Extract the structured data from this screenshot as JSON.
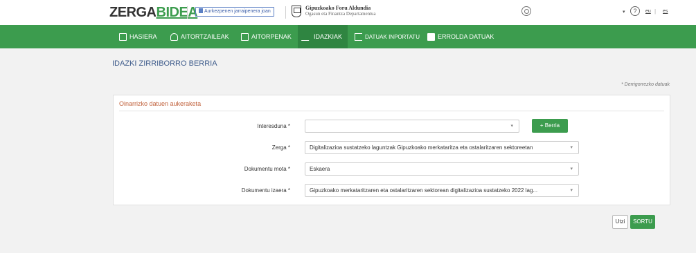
{
  "header": {
    "logo_part1": "ZERGA",
    "logo_part2": "BIDEA",
    "followup_label": "Aurkezpenen jarraipenera joan",
    "dept_line1": "Gipuzkoako Foru Aldundia",
    "dept_line2": "Ogasun eta Finantza Departamentua",
    "help_label": "?",
    "user_caret": "▾",
    "lang_eu": "eu",
    "lang_sep": "|",
    "lang_es": "es"
  },
  "nav": {
    "items": [
      {
        "label": "HASIERA",
        "icon": "home-icon"
      },
      {
        "label": "AITORTZAILEAK",
        "icon": "person-icon"
      },
      {
        "label": "AITORPENAK",
        "icon": "edit-icon"
      },
      {
        "label": "IDAZKIAK",
        "icon": "pen-icon",
        "active": true
      },
      {
        "label": "DATUAK INPORTATU",
        "icon": "import-icon"
      },
      {
        "label": "ERROLDA DATUAK",
        "icon": "id-card-icon"
      }
    ]
  },
  "page": {
    "title": "IDAZKI ZIRRIBORRO BERRIA",
    "required_note": "* Derrigorrezko datuak"
  },
  "form": {
    "section_title": "Oinarrizko datuen aukeraketa",
    "interested": {
      "label": "Interesduna *",
      "value": ""
    },
    "new_button": "+ Berria",
    "tax": {
      "label": "Zerga *",
      "value": "Digitalizazioa sustatzeko laguntzak Gipuzkoako merkataritza eta ostalaritzaren sektoreetan"
    },
    "doc_type": {
      "label": "Dokumentu mota *",
      "value": "Eskaera"
    },
    "doc_nature": {
      "label": "Dokumentu izaera *",
      "value": "Gipuzkoako merkataritzaren eta ostalaritzaren sektorean digitalizazioa sustatzeko 2022 lag..."
    }
  },
  "actions": {
    "cancel": "Utzi",
    "create": "SORTU"
  },
  "colors": {
    "brand_green": "#3c9c4e",
    "section_title": "#c0603a",
    "page_title": "#3c5a8a"
  }
}
